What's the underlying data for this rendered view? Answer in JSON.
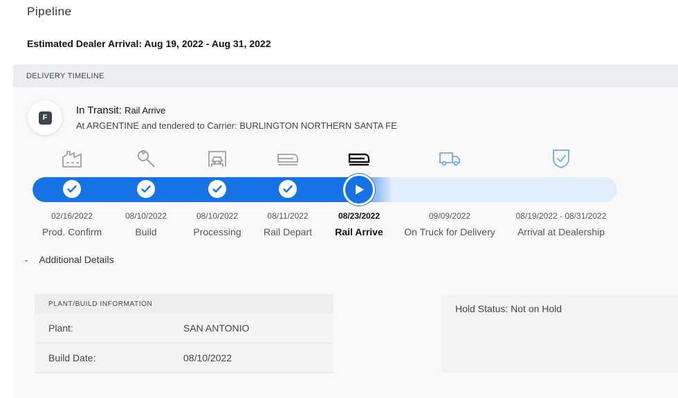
{
  "page": {
    "title": "Pipeline",
    "estimated_arrival": "Estimated Dealer Arrival: Aug 19, 2022 - Aug 31, 2022"
  },
  "timeline": {
    "header": "DELIVERY TIMELINE",
    "badge_letter": "F",
    "status_main": "In Transit:",
    "status_sub": "Rail Arrive",
    "status_detail": "At ARGENTINE and tendered to Carrier: BURLINGTON NORTHERN SANTA FE",
    "steps": [
      {
        "date": "02/16/2022",
        "label": "Prod. Confirm",
        "state": "complete",
        "icon": "factory-icon"
      },
      {
        "date": "08/10/2022",
        "label": "Build",
        "state": "complete",
        "icon": "wrench-icon"
      },
      {
        "date": "08/10/2022",
        "label": "Processing",
        "state": "complete",
        "icon": "car-garage-icon"
      },
      {
        "date": "08/11/2022",
        "label": "Rail Depart",
        "state": "complete",
        "icon": "train-icon"
      },
      {
        "date": "08/23/2022",
        "label": "Rail Arrive",
        "state": "current",
        "icon": "train-icon"
      },
      {
        "date": "09/09/2022",
        "label": "On Truck for Delivery",
        "state": "upcoming",
        "icon": "truck-icon"
      },
      {
        "date": "08/19/2022 - 08/31/2022",
        "label": "Arrival at Dealership",
        "state": "upcoming",
        "icon": "shield-check-icon"
      }
    ],
    "colors": {
      "accent": "#1673e6",
      "track": "#e2edfd",
      "icon_done": "#9aa0a6",
      "icon_current": "#111111",
      "icon_upcoming": "#6fa8e8"
    }
  },
  "details": {
    "toggle_label": "Additional Details",
    "plant": {
      "header": "PLANT/BUILD INFORMATION",
      "rows": [
        {
          "key": "Plant:",
          "value": "SAN ANTONIO"
        },
        {
          "key": "Build Date:",
          "value": "08/10/2022"
        }
      ]
    },
    "hold_status": "Hold Status: Not on Hold"
  }
}
